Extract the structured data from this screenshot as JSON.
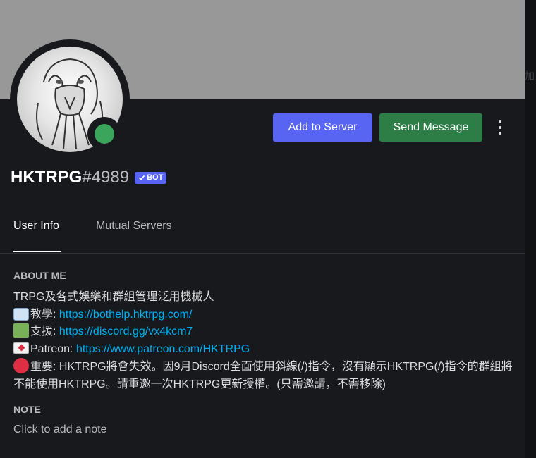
{
  "profile": {
    "username": "HKTRPG",
    "discriminator": "#4989",
    "bot_badge": "BOT",
    "status": "online"
  },
  "actions": {
    "add_to_server": "Add to Server",
    "send_message": "Send Message"
  },
  "tabs": [
    {
      "label": "User Info",
      "active": true
    },
    {
      "label": "Mutual Servers",
      "active": false
    }
  ],
  "about": {
    "title": "ABOUT ME",
    "intro": "TRPG及各式娛樂和群組管理泛用機械人",
    "lines": [
      {
        "icon": "open-book-icon",
        "label": "教學: ",
        "link": "https://bothelp.hktrpg.com/"
      },
      {
        "icon": "green-square-icon",
        "label": "支援: ",
        "link": "https://discord.gg/vx4kcm7"
      },
      {
        "icon": "love-letter-icon",
        "label": "Patreon: ",
        "link": "https://www.patreon.com/HKTRPG"
      }
    ],
    "notice_icon": "red-circle-icon",
    "notice": "重要: HKTRPG將會失效。因9月Discord全面使用斜線(/)指令，沒有顯示HKTRPG(/)指令的群組將不能使用HKTRPG。請重邀一次HKTRPG更新授權。(只需邀請，不需移除)"
  },
  "note": {
    "title": "NOTE",
    "placeholder": "Click to add a note"
  },
  "colors": {
    "blurple": "#5865f2",
    "send_green": "#2d7d46",
    "online": "#3ba55c",
    "link": "#00aff4",
    "banner": "#989898",
    "background": "#18191c"
  }
}
